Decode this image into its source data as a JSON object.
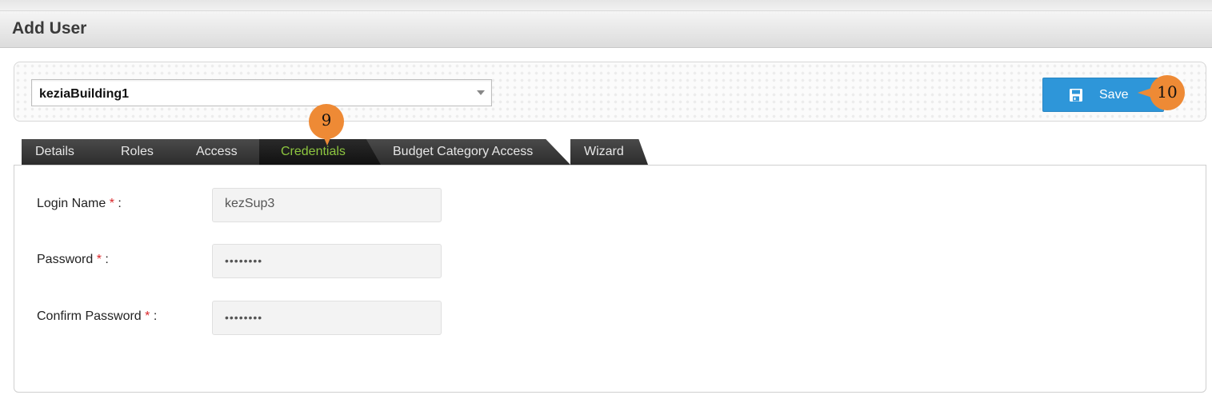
{
  "header": {
    "title": "Add User"
  },
  "building_select": {
    "value": "keziaBuilding1"
  },
  "toolbar": {
    "save_label": "Save"
  },
  "callouts": {
    "tab_step": "9",
    "save_step": "10"
  },
  "tabs": [
    {
      "label": "Details",
      "active": false
    },
    {
      "label": "Roles",
      "active": false
    },
    {
      "label": "Access",
      "active": false
    },
    {
      "label": "Credentials",
      "active": true
    },
    {
      "label": "Budget Category Access",
      "active": false
    },
    {
      "label": "Wizard",
      "active": false
    }
  ],
  "form": {
    "required_marker": "*",
    "login_name": {
      "label": "Login Name",
      "value": "kezSup3"
    },
    "password": {
      "label": "Password",
      "value": "••••••••"
    },
    "confirm_password": {
      "label": "Confirm Password",
      "value": "••••••••"
    }
  },
  "colors": {
    "save_button": "#2e96d9",
    "callout": "#ee8a35",
    "active_tab_text": "#8dc63f",
    "required": "#d9262a"
  }
}
